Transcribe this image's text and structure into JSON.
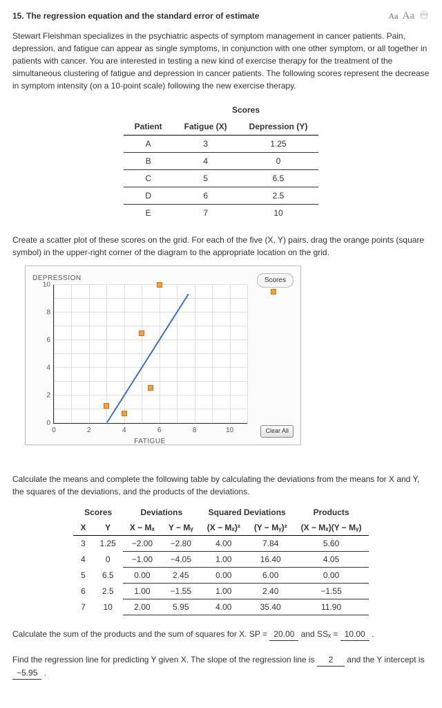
{
  "header": {
    "number": "15.",
    "title": "The regression equation and the standard error of estimate",
    "font_small_label": "Aa",
    "font_large_label": "Aa"
  },
  "intro": "Stewart Fleishman specializes in the psychiatric aspects of symptom management in cancer patients. Pain, depression, and fatigue can appear as single symptoms, in conjunction with one other symptom, or all together in patients with cancer. You are interested in testing a new kind of exercise therapy for the treatment of the simultaneous clustering of fatigue and depression in cancer patients. The following scores represent the decrease in symptom intensity (on a 10-point scale) following the new exercise therapy.",
  "scores_table": {
    "super_header": "Scores",
    "cols": {
      "patient": "Patient",
      "x": "Fatigue (X)",
      "y": "Depression (Y)"
    },
    "rows": [
      {
        "p": "A",
        "x": "3",
        "y": "1.25"
      },
      {
        "p": "B",
        "x": "4",
        "y": "0"
      },
      {
        "p": "C",
        "x": "5",
        "y": "6.5"
      },
      {
        "p": "D",
        "x": "6",
        "y": "2.5"
      },
      {
        "p": "E",
        "x": "7",
        "y": "10"
      }
    ]
  },
  "scatter_instruction": "Create a scatter plot of these scores on the grid. For each of the five (X, Y) pairs, drag the orange points (square symbol) in the upper-right corner of the diagram to the appropriate location on the grid.",
  "plot": {
    "ylabel": "DEPRESSION",
    "xlabel": "FATIGUE",
    "legend": "Scores",
    "clear": "Clear All",
    "yticks": [
      "0",
      "2",
      "4",
      "6",
      "8",
      "10"
    ],
    "xticks": [
      "0",
      "2",
      "4",
      "6",
      "8",
      "10"
    ]
  },
  "chart_data": {
    "type": "scatter",
    "title": "DEPRESSION vs FATIGUE",
    "xlabel": "FATIGUE",
    "ylabel": "DEPRESSION",
    "xlim": [
      0,
      11
    ],
    "ylim": [
      0,
      10
    ],
    "series": [
      {
        "name": "Scores",
        "points": [
          {
            "x": 3,
            "y": 1.25
          },
          {
            "x": 4,
            "y": 0.7
          },
          {
            "x": 5,
            "y": 6.5
          },
          {
            "x": 5.5,
            "y": 2.55
          },
          {
            "x": 6,
            "y": 10
          }
        ]
      },
      {
        "name": "Regression line",
        "type": "line",
        "points": [
          {
            "x": 3,
            "y": 0.05
          },
          {
            "x": 8,
            "y": 10.05
          }
        ]
      }
    ]
  },
  "dev_intro": "Calculate the means and complete the following table by calculating the deviations from the means for X and Y, the squares of the deviations, and the products of the deviations.",
  "dev_table": {
    "groups": {
      "scores": "Scores",
      "dev": "Deviations",
      "sq": "Squared Deviations",
      "prod": "Products"
    },
    "cols": {
      "x": "X",
      "y": "Y",
      "dx": "X − Mₓ",
      "dy": "Y − Mᵧ",
      "dx2": "(X − Mₓ)²",
      "dy2": "(Y − Mᵧ)²",
      "dxdy": "(X − Mₓ)(Y − Mᵧ)"
    },
    "rows": [
      {
        "x": "3",
        "y": "1.25",
        "dx": "−2.00",
        "dy": "−2.80",
        "dx2": "4.00",
        "dy2": "7.84",
        "dxdy": "5.60"
      },
      {
        "x": "4",
        "y": "0",
        "dx": "−1.00",
        "dy": "−4.05",
        "dx2": "1.00",
        "dy2": "16.40",
        "dxdy": "4.05"
      },
      {
        "x": "5",
        "y": "6.5",
        "dx": "0.00",
        "dy": "2.45",
        "dx2": "0.00",
        "dy2": "6.00",
        "dxdy": "0.00"
      },
      {
        "x": "6",
        "y": "2.5",
        "dx": "1.00",
        "dy": "−1.55",
        "dx2": "1.00",
        "dy2": "2.40",
        "dxdy": "−1.55"
      },
      {
        "x": "7",
        "y": "10",
        "dx": "2.00",
        "dy": "5.95",
        "dx2": "4.00",
        "dy2": "35.40",
        "dxdy": "11.90"
      }
    ]
  },
  "sums": {
    "pre": "Calculate the sum of the products and the sum of squares for X. SP = ",
    "sp": "20.00",
    "mid": " and SSₓ = ",
    "ssx": "10.00",
    "end": " ."
  },
  "reg": {
    "pre": "Find the regression line for predicting Y given X. The slope of the regression line is ",
    "slope": "2",
    "mid": " and the Y intercept is ",
    "intercept": "−5.95",
    "end": " ."
  }
}
